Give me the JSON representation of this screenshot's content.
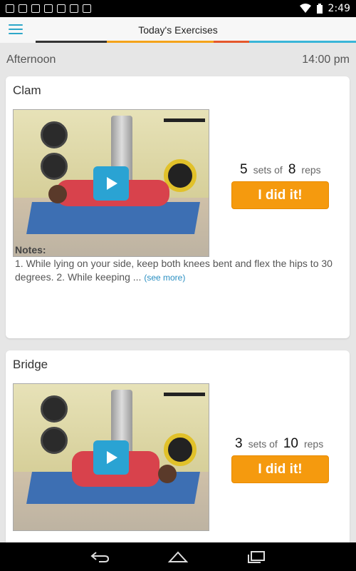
{
  "status_bar": {
    "time": "2:49",
    "left_icons": [
      "mail-icon",
      "image-icon",
      "gmail-icon",
      "download-icon",
      "sd-card-icon",
      "store-icon",
      "barcode-icon"
    ],
    "right_icons": [
      "wifi-icon",
      "battery-icon"
    ]
  },
  "app_bar": {
    "title": "Today's Exercises",
    "menu_icon": "hamburger-menu-icon",
    "accent_colors": [
      "#333333",
      "#f4a31a",
      "#e5572b",
      "#39b5d8"
    ]
  },
  "section": {
    "label": "Afternoon",
    "time": "14:00 pm"
  },
  "exercises": [
    {
      "name": "Clam",
      "sets": "5",
      "sets_label": "sets of",
      "reps": "8",
      "reps_label": "reps",
      "button_label": "I did it!",
      "notes_title": "Notes:",
      "notes_text": "1. While lying on your side, keep both knees bent and flex the hips to 30 degrees. 2. While keeping ...",
      "see_more": "(see more)"
    },
    {
      "name": "Bridge",
      "sets": "3",
      "sets_label": "sets of",
      "reps": "10",
      "reps_label": "reps",
      "button_label": "I did it!"
    }
  ],
  "colors": {
    "accent_blue": "#2ea7c9",
    "button_orange": "#f59a0e",
    "link_blue": "#2a8fc2"
  },
  "nav_bar": {
    "icons": [
      "back-icon",
      "home-icon",
      "recent-apps-icon"
    ]
  }
}
